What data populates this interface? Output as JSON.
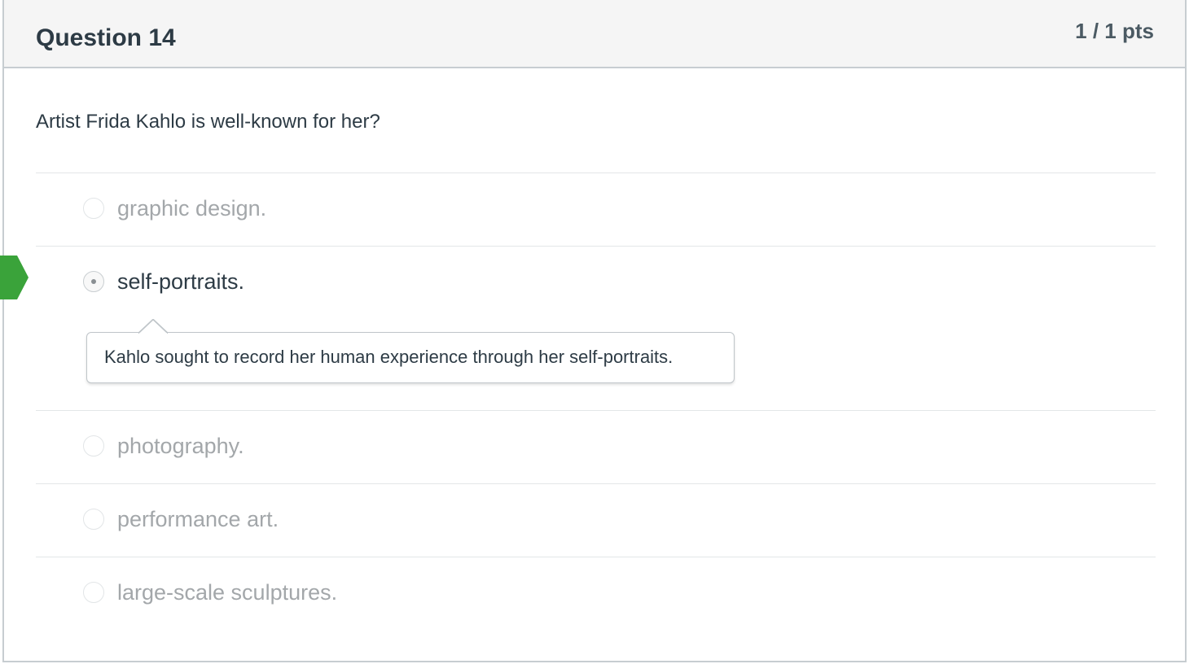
{
  "question": {
    "title": "Question 14",
    "points": "1 / 1 pts",
    "text": "Artist Frida Kahlo is well-known for her?"
  },
  "answers": [
    {
      "label": "graphic design.",
      "selected": false
    },
    {
      "label": "self-portraits.",
      "selected": true
    },
    {
      "label": "photography.",
      "selected": false
    },
    {
      "label": "performance art.",
      "selected": false
    },
    {
      "label": "large-scale sculptures.",
      "selected": false
    }
  ],
  "feedback": {
    "text": "Kahlo sought to record her human experience through her self-portraits."
  },
  "indicator": {
    "icon": "correct-answer-arrow-icon",
    "color": "#3aa33a"
  }
}
